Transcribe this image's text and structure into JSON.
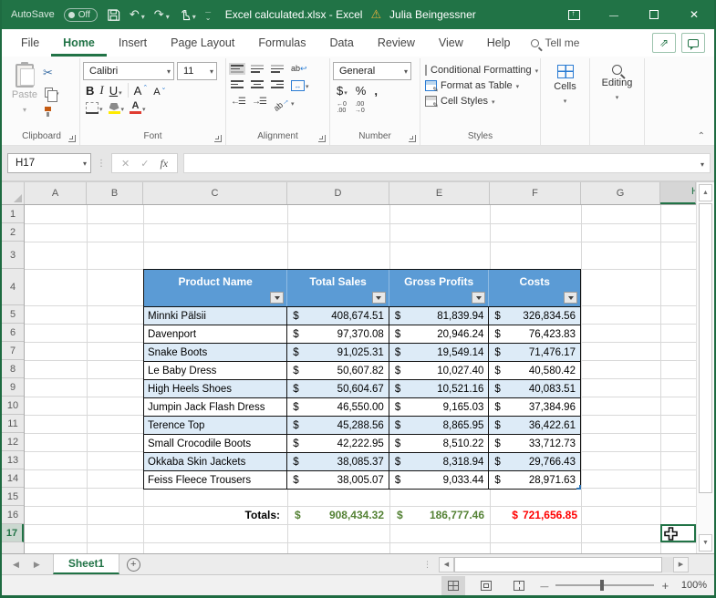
{
  "titlebar": {
    "autosave_label": "AutoSave",
    "autosave_state": "Off",
    "title": "Excel calculated.xlsx  -  Excel",
    "user": "Julia Beingessner"
  },
  "ribbon_tabs": {
    "file": "File",
    "home": "Home",
    "insert": "Insert",
    "page_layout": "Page Layout",
    "formulas": "Formulas",
    "data": "Data",
    "review": "Review",
    "view": "View",
    "help": "Help",
    "tell_me": "Tell me"
  },
  "ribbon": {
    "clipboard": {
      "group_label": "Clipboard",
      "paste_label": "Paste"
    },
    "font": {
      "group_label": "Font",
      "font_name": "Calibri",
      "font_size": "11",
      "bold": "B",
      "italic": "I",
      "underline": "U",
      "grow": "A",
      "shrink": "A"
    },
    "alignment": {
      "group_label": "Alignment",
      "wrap_ab": "ab",
      "orient_ab": "ab"
    },
    "number": {
      "group_label": "Number",
      "format": "General",
      "currency": "$",
      "percent": "%",
      "comma": ",",
      "inc_decimal": "←0\n.00",
      "dec_decimal": ".00\n→0"
    },
    "styles": {
      "group_label": "Styles",
      "conditional": "Conditional Formatting",
      "format_table": "Format as Table",
      "cell_styles": "Cell Styles"
    },
    "cells": {
      "label": "Cells"
    },
    "editing": {
      "label": "Editing"
    }
  },
  "formula_bar": {
    "name_box": "H17",
    "fx": "fx",
    "value": ""
  },
  "grid": {
    "columns": [
      "A",
      "B",
      "C",
      "D",
      "E",
      "F",
      "G",
      "H"
    ],
    "rows": [
      "1",
      "2",
      "3",
      "4",
      "5",
      "6",
      "7",
      "8",
      "9",
      "10",
      "11",
      "12",
      "13",
      "14",
      "15",
      "16",
      "17"
    ]
  },
  "table": {
    "currency": "$",
    "headers": [
      "Product Name",
      "Total Sales",
      "Gross Profits",
      "Costs"
    ],
    "rows": [
      {
        "name": "Minnki Pälsii",
        "sales": "408,674.51",
        "profits": "81,839.94",
        "costs": "326,834.56"
      },
      {
        "name": "Davenport",
        "sales": "97,370.08",
        "profits": "20,946.24",
        "costs": "76,423.83"
      },
      {
        "name": "Snake Boots",
        "sales": "91,025.31",
        "profits": "19,549.14",
        "costs": "71,476.17"
      },
      {
        "name": "Le Baby Dress",
        "sales": "50,607.82",
        "profits": "10,027.40",
        "costs": "40,580.42"
      },
      {
        "name": "High Heels Shoes",
        "sales": "50,604.67",
        "profits": "10,521.16",
        "costs": "40,083.51"
      },
      {
        "name": "Jumpin Jack Flash Dress",
        "sales": "46,550.00",
        "profits": "9,165.03",
        "costs": "37,384.96"
      },
      {
        "name": "Terence Top",
        "sales": "45,288.56",
        "profits": "8,865.95",
        "costs": "36,422.61"
      },
      {
        "name": "Small Crocodile Boots",
        "sales": "42,222.95",
        "profits": "8,510.22",
        "costs": "33,712.73"
      },
      {
        "name": "Okkaba Skin Jackets",
        "sales": "38,085.37",
        "profits": "8,318.94",
        "costs": "29,766.43"
      },
      {
        "name": "Feiss Fleece Trousers",
        "sales": "38,005.07",
        "profits": "9,033.44",
        "costs": "28,971.63"
      }
    ],
    "totals_label": "Totals:",
    "totals": {
      "sales": "908,434.32",
      "profits": "186,777.46",
      "costs": "721,656.85"
    }
  },
  "sheetbar": {
    "active_tab": "Sheet1"
  },
  "statusbar": {
    "zoom_level": "100%"
  },
  "colors": {
    "accent_green": "#217346",
    "header_blue": "#5B9BD5",
    "band_blue": "#DDEBF7",
    "totals_green": "#548235",
    "totals_red": "#FF0000"
  }
}
